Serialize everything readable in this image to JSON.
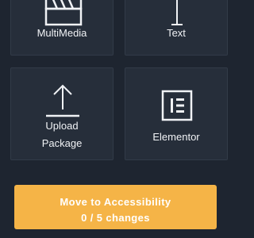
{
  "widgets": [
    {
      "label": "MultiMedia",
      "icon": "clapperboard-icon"
    },
    {
      "label": "Text",
      "icon": "text-cursor-icon"
    },
    {
      "label_lines": [
        "Upload",
        "Package"
      ],
      "icon": "upload-icon"
    },
    {
      "label": "Elementor",
      "icon": "elementor-icon"
    }
  ],
  "cta": {
    "title": "Move to Accessibility",
    "subtitle": "0 / 5 changes",
    "color": "#f5b447"
  },
  "colors": {
    "background": "#1e2530",
    "tile": "#262e3a",
    "text": "#f0f2f5"
  }
}
